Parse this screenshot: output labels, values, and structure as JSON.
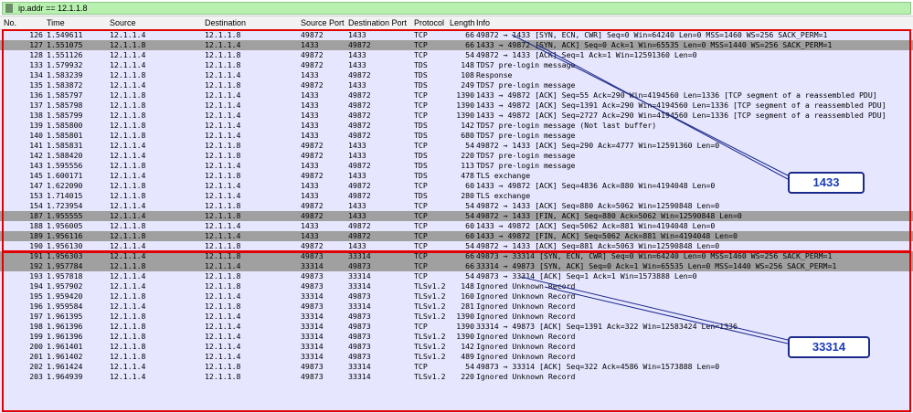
{
  "filter": {
    "value": "ip.addr == 12.1.1.8"
  },
  "columns": [
    "No.",
    "Time",
    "Source",
    "Destination",
    "Source Port",
    "Destination Port",
    "Protocol",
    "Length",
    "Info"
  ],
  "packets": [
    {
      "no": "126",
      "time": "1.549611",
      "src": "12.1.1.4",
      "dst": "12.1.1.8",
      "sp": "49872",
      "dp": "1433",
      "proto": "TCP",
      "len": "66",
      "info": "49872 → 1433 [SYN, ECN, CWR] Seq=0 Win=64240 Len=0 MSS=1460 WS=256 SACK_PERM=1",
      "style": "tcp"
    },
    {
      "no": "127",
      "time": "1.551075",
      "src": "12.1.1.8",
      "dst": "12.1.1.4",
      "sp": "1433",
      "dp": "49872",
      "proto": "TCP",
      "len": "66",
      "info": "1433 → 49872 [SYN, ACK] Seq=0 Ack=1 Win=65535 Len=0 MSS=1440 WS=256 SACK_PERM=1",
      "style": "sel"
    },
    {
      "no": "128",
      "time": "1.551126",
      "src": "12.1.1.4",
      "dst": "12.1.1.8",
      "sp": "49872",
      "dp": "1433",
      "proto": "TCP",
      "len": "54",
      "info": "49872 → 1433 [ACK] Seq=1 Ack=1 Win=12591360 Len=0",
      "style": "tcp"
    },
    {
      "no": "133",
      "time": "1.579932",
      "src": "12.1.1.4",
      "dst": "12.1.1.8",
      "sp": "49872",
      "dp": "1433",
      "proto": "TDS",
      "len": "148",
      "info": "TDS7 pre-login message",
      "style": "tds"
    },
    {
      "no": "134",
      "time": "1.583239",
      "src": "12.1.1.8",
      "dst": "12.1.1.4",
      "sp": "1433",
      "dp": "49872",
      "proto": "TDS",
      "len": "108",
      "info": "Response",
      "style": "tds"
    },
    {
      "no": "135",
      "time": "1.583872",
      "src": "12.1.1.4",
      "dst": "12.1.1.8",
      "sp": "49872",
      "dp": "1433",
      "proto": "TDS",
      "len": "249",
      "info": "TDS7 pre-login message",
      "style": "tds"
    },
    {
      "no": "136",
      "time": "1.585797",
      "src": "12.1.1.8",
      "dst": "12.1.1.4",
      "sp": "1433",
      "dp": "49872",
      "proto": "TCP",
      "len": "1390",
      "info": "1433 → 49872 [ACK] Seq=55 Ack=290 Win=4194560 Len=1336 [TCP segment of a reassembled PDU]",
      "style": "tcp"
    },
    {
      "no": "137",
      "time": "1.585798",
      "src": "12.1.1.8",
      "dst": "12.1.1.4",
      "sp": "1433",
      "dp": "49872",
      "proto": "TCP",
      "len": "1390",
      "info": "1433 → 49872 [ACK] Seq=1391 Ack=290 Win=4194560 Len=1336 [TCP segment of a reassembled PDU]",
      "style": "tcp"
    },
    {
      "no": "138",
      "time": "1.585799",
      "src": "12.1.1.8",
      "dst": "12.1.1.4",
      "sp": "1433",
      "dp": "49872",
      "proto": "TCP",
      "len": "1390",
      "info": "1433 → 49872 [ACK] Seq=2727 Ack=290 Win=4194560 Len=1336 [TCP segment of a reassembled PDU]",
      "style": "tcp"
    },
    {
      "no": "139",
      "time": "1.585800",
      "src": "12.1.1.8",
      "dst": "12.1.1.4",
      "sp": "1433",
      "dp": "49872",
      "proto": "TDS",
      "len": "142",
      "info": "TDS7 pre-login message (Not last buffer)",
      "style": "tds"
    },
    {
      "no": "140",
      "time": "1.585801",
      "src": "12.1.1.8",
      "dst": "12.1.1.4",
      "sp": "1433",
      "dp": "49872",
      "proto": "TDS",
      "len": "680",
      "info": "TDS7 pre-login message",
      "style": "tds"
    },
    {
      "no": "141",
      "time": "1.585831",
      "src": "12.1.1.4",
      "dst": "12.1.1.8",
      "sp": "49872",
      "dp": "1433",
      "proto": "TCP",
      "len": "54",
      "info": "49872 → 1433 [ACK] Seq=290 Ack=4777 Win=12591360 Len=0",
      "style": "tcp"
    },
    {
      "no": "142",
      "time": "1.588420",
      "src": "12.1.1.4",
      "dst": "12.1.1.8",
      "sp": "49872",
      "dp": "1433",
      "proto": "TDS",
      "len": "220",
      "info": "TDS7 pre-login message",
      "style": "tds"
    },
    {
      "no": "143",
      "time": "1.595556",
      "src": "12.1.1.8",
      "dst": "12.1.1.4",
      "sp": "1433",
      "dp": "49872",
      "proto": "TDS",
      "len": "113",
      "info": "TDS7 pre-login message",
      "style": "tds"
    },
    {
      "no": "145",
      "time": "1.600171",
      "src": "12.1.1.4",
      "dst": "12.1.1.8",
      "sp": "49872",
      "dp": "1433",
      "proto": "TDS",
      "len": "478",
      "info": "TLS exchange",
      "style": "tds"
    },
    {
      "no": "147",
      "time": "1.622090",
      "src": "12.1.1.8",
      "dst": "12.1.1.4",
      "sp": "1433",
      "dp": "49872",
      "proto": "TCP",
      "len": "60",
      "info": "1433 → 49872 [ACK] Seq=4836 Ack=880 Win=4194048 Len=0",
      "style": "tcp"
    },
    {
      "no": "153",
      "time": "1.714015",
      "src": "12.1.1.8",
      "dst": "12.1.1.4",
      "sp": "1433",
      "dp": "49872",
      "proto": "TDS",
      "len": "280",
      "info": "TLS exchange",
      "style": "tds"
    },
    {
      "no": "154",
      "time": "1.723954",
      "src": "12.1.1.4",
      "dst": "12.1.1.8",
      "sp": "49872",
      "dp": "1433",
      "proto": "TCP",
      "len": "54",
      "info": "49872 → 1433 [ACK] Seq=880 Ack=5062 Win=12590848 Len=0",
      "style": "tcp"
    },
    {
      "no": "187",
      "time": "1.955555",
      "src": "12.1.1.4",
      "dst": "12.1.1.8",
      "sp": "49872",
      "dp": "1433",
      "proto": "TCP",
      "len": "54",
      "info": "49872 → 1433 [FIN, ACK] Seq=880 Ack=5062 Win=12590848 Len=0",
      "style": "fin"
    },
    {
      "no": "188",
      "time": "1.956005",
      "src": "12.1.1.8",
      "dst": "12.1.1.4",
      "sp": "1433",
      "dp": "49872",
      "proto": "TCP",
      "len": "60",
      "info": "1433 → 49872 [ACK] Seq=5062 Ack=881 Win=4194048 Len=0",
      "style": "tcp"
    },
    {
      "no": "189",
      "time": "1.956116",
      "src": "12.1.1.8",
      "dst": "12.1.1.4",
      "sp": "1433",
      "dp": "49872",
      "proto": "TCP",
      "len": "60",
      "info": "1433 → 49872 [FIN, ACK] Seq=5062 Ack=881 Win=4194048 Len=0",
      "style": "fin"
    },
    {
      "no": "190",
      "time": "1.956130",
      "src": "12.1.1.4",
      "dst": "12.1.1.8",
      "sp": "49872",
      "dp": "1433",
      "proto": "TCP",
      "len": "54",
      "info": "49872 → 1433 [ACK] Seq=881 Ack=5063 Win=12590848 Len=0",
      "style": "tcp"
    },
    {
      "no": "191",
      "time": "1.956303",
      "src": "12.1.1.4",
      "dst": "12.1.1.8",
      "sp": "49873",
      "dp": "33314",
      "proto": "TCP",
      "len": "66",
      "info": "49873 → 33314 [SYN, ECN, CWR] Seq=0 Win=64240 Len=0 MSS=1460 WS=256 SACK_PERM=1",
      "style": "sel"
    },
    {
      "no": "192",
      "time": "1.957784",
      "src": "12.1.1.8",
      "dst": "12.1.1.4",
      "sp": "33314",
      "dp": "49873",
      "proto": "TCP",
      "len": "66",
      "info": "33314 → 49873 [SYN, ACK] Seq=0 Ack=1 Win=65535 Len=0 MSS=1440 WS=256 SACK_PERM=1",
      "style": "sel"
    },
    {
      "no": "193",
      "time": "1.957818",
      "src": "12.1.1.4",
      "dst": "12.1.1.8",
      "sp": "49873",
      "dp": "33314",
      "proto": "TCP",
      "len": "54",
      "info": "49873 → 33314 [ACK] Seq=1 Ack=1 Win=1573888 Len=0",
      "style": "tcp"
    },
    {
      "no": "194",
      "time": "1.957902",
      "src": "12.1.1.4",
      "dst": "12.1.1.8",
      "sp": "49873",
      "dp": "33314",
      "proto": "TLSv1.2",
      "len": "148",
      "info": "Ignored Unknown Record",
      "style": "tds"
    },
    {
      "no": "195",
      "time": "1.959420",
      "src": "12.1.1.8",
      "dst": "12.1.1.4",
      "sp": "33314",
      "dp": "49873",
      "proto": "TLSv1.2",
      "len": "160",
      "info": "Ignored Unknown Record",
      "style": "tds"
    },
    {
      "no": "196",
      "time": "1.959584",
      "src": "12.1.1.4",
      "dst": "12.1.1.8",
      "sp": "49873",
      "dp": "33314",
      "proto": "TLSv1.2",
      "len": "281",
      "info": "Ignored Unknown Record",
      "style": "tds"
    },
    {
      "no": "197",
      "time": "1.961395",
      "src": "12.1.1.8",
      "dst": "12.1.1.4",
      "sp": "33314",
      "dp": "49873",
      "proto": "TLSv1.2",
      "len": "1390",
      "info": "Ignored Unknown Record",
      "style": "tds"
    },
    {
      "no": "198",
      "time": "1.961396",
      "src": "12.1.1.8",
      "dst": "12.1.1.4",
      "sp": "33314",
      "dp": "49873",
      "proto": "TCP",
      "len": "1390",
      "info": "33314 → 49873 [ACK] Seq=1391 Ack=322 Win=12583424 Len=1336",
      "style": "tcp"
    },
    {
      "no": "199",
      "time": "1.961396",
      "src": "12.1.1.8",
      "dst": "12.1.1.4",
      "sp": "33314",
      "dp": "49873",
      "proto": "TLSv1.2",
      "len": "1390",
      "info": "Ignored Unknown Record",
      "style": "tds"
    },
    {
      "no": "200",
      "time": "1.961401",
      "src": "12.1.1.8",
      "dst": "12.1.1.4",
      "sp": "33314",
      "dp": "49873",
      "proto": "TLSv1.2",
      "len": "142",
      "info": "Ignored Unknown Record",
      "style": "tds"
    },
    {
      "no": "201",
      "time": "1.961402",
      "src": "12.1.1.8",
      "dst": "12.1.1.4",
      "sp": "33314",
      "dp": "49873",
      "proto": "TLSv1.2",
      "len": "489",
      "info": "Ignored Unknown Record",
      "style": "tds"
    },
    {
      "no": "202",
      "time": "1.961424",
      "src": "12.1.1.4",
      "dst": "12.1.1.8",
      "sp": "49873",
      "dp": "33314",
      "proto": "TCP",
      "len": "54",
      "info": "49873 → 33314 [ACK] Seq=322 Ack=4586 Win=1573888 Len=0",
      "style": "tcp"
    },
    {
      "no": "203",
      "time": "1.964939",
      "src": "12.1.1.4",
      "dst": "12.1.1.8",
      "sp": "49873",
      "dp": "33314",
      "proto": "TLSv1.2",
      "len": "220",
      "info": "Ignored Unknown Record",
      "style": "tds"
    }
  ],
  "annotations": {
    "callout_1": "1433",
    "callout_2": "33314",
    "border_color": "#e00000",
    "callout_color": "#1b3db8"
  }
}
